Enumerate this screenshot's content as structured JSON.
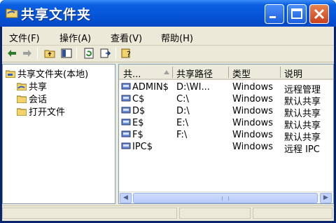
{
  "window": {
    "title": "共享文件夹"
  },
  "menu": [
    "文件(F)",
    "操作(A)",
    "查看(V)",
    "帮助(H)"
  ],
  "toolbar": [
    "back-icon",
    "forward-icon",
    "up-folder-icon",
    "show-hide-tree-icon",
    "refresh-icon",
    "export-list-icon",
    "help-icon"
  ],
  "tree": {
    "root": "共享文件夹(本地)",
    "children": [
      "共享",
      "会话",
      "打开文件"
    ]
  },
  "list": {
    "columns": [
      "共...",
      "共享路径",
      "类型",
      "说明"
    ],
    "rows": [
      {
        "name": "ADMIN$",
        "path": "D:\\WI...",
        "type": "Windows",
        "desc": "远程管理"
      },
      {
        "name": "C$",
        "path": "C:\\",
        "type": "Windows",
        "desc": "默认共享"
      },
      {
        "name": "D$",
        "path": "D:\\",
        "type": "Windows",
        "desc": "默认共享"
      },
      {
        "name": "E$",
        "path": "E:\\",
        "type": "Windows",
        "desc": "默认共享"
      },
      {
        "name": "F$",
        "path": "F:\\",
        "type": "Windows",
        "desc": "默认共享"
      },
      {
        "name": "IPC$",
        "path": "",
        "type": "Windows",
        "desc": "远程 IPC"
      }
    ]
  },
  "colors": {
    "titlebar": "#0554d8",
    "close": "#c9401d",
    "chrome": "#ece9d8"
  }
}
